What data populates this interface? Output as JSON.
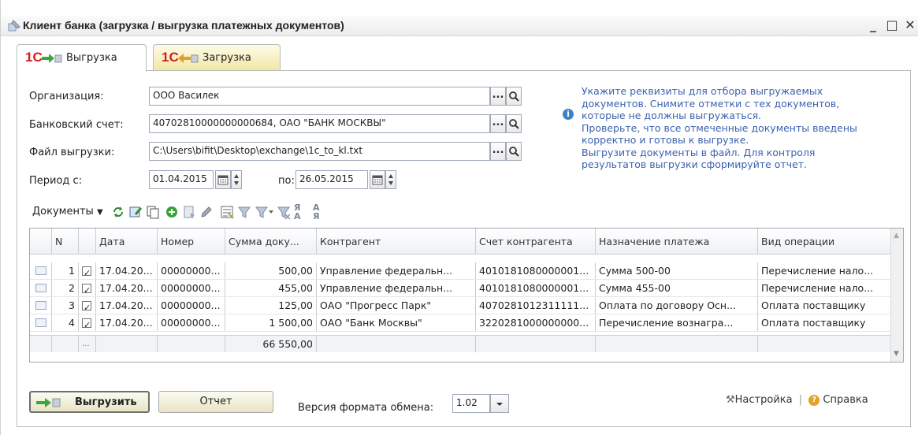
{
  "window": {
    "title": "Клиент банка (загрузка / выгрузка платежных документов)",
    "minimize_label": "_",
    "maximize_label": "□",
    "close_label": "✕"
  },
  "tabs": [
    {
      "label": "Выгрузка",
      "active": true
    },
    {
      "label": "Загрузка",
      "active": false
    }
  ],
  "form": {
    "organization_label": "Организация:",
    "organization_value": "ООО Василек",
    "bank_account_label": "Банковский счет:",
    "bank_account_value": "40702810000000000684, ОАО \"БАНК МОСКВЫ\"",
    "file_label": "Файл выгрузки:",
    "file_value": "C:\\Users\\bifit\\Desktop\\exchange\\1c_to_kl.txt",
    "period_label": "Период с:",
    "period_from": "01.04.2015",
    "period_to_label": "по:",
    "period_to": "26.05.2015",
    "select_button_label": "..."
  },
  "info": {
    "lines": [
      "Укажите реквизиты для отбора выгружаемых",
      "документов. Снимите отметки с тех документов,",
      "которые не должны выгружаться.",
      "Проверьте, что все отмеченные документы введены",
      "корректно и готовы к выгрузке.",
      "Выгрузите документы в файл. Для контроля",
      "результатов выгрузки сформируйте отчет."
    ]
  },
  "toolbar": {
    "documents_label": "Документы"
  },
  "table": {
    "columns": [
      "N",
      "",
      "Дата",
      "Номер",
      "Сумма доку...",
      "Контрагент",
      "Счет контрагента",
      "Назначение платежа",
      "Вид операции"
    ],
    "rows": [
      {
        "n": "1",
        "checked": true,
        "date": "17.04.20...",
        "number": "00000000...",
        "sum": "500,00",
        "counterparty": "Управление федеральн...",
        "account": "4010181080000001...",
        "purpose": "Сумма 500-00",
        "operation": "Перечисление нало..."
      },
      {
        "n": "2",
        "checked": true,
        "date": "17.04.20...",
        "number": "00000000...",
        "sum": "455,00",
        "counterparty": "Управление федеральн...",
        "account": "4010181080000001...",
        "purpose": "Сумма 455-00",
        "operation": "Перечисление нало..."
      },
      {
        "n": "3",
        "checked": true,
        "date": "17.04.20...",
        "number": "00000000...",
        "sum": "125,00",
        "counterparty": "ОАО \"Прогресс Парк\"",
        "account": "4070281012311111...",
        "purpose": "Оплата по договору Осн...",
        "operation": "Оплата поставщику"
      },
      {
        "n": "4",
        "checked": true,
        "date": "17.04.20...",
        "number": "00000000...",
        "sum": "1 500,00",
        "counterparty": "ОАО \"Банк Москвы\"",
        "account": "3220281000000000...",
        "purpose": "Перечисление вознагра...",
        "operation": "Оплата поставщику"
      }
    ],
    "footer": {
      "check": "...",
      "total": "66 550,00"
    }
  },
  "footer": {
    "export_button": "Выгрузить",
    "report_button": "Отчет",
    "version_label": "Версия формата обмена:",
    "version_value": "1.02",
    "settings_link": "Настройка",
    "separator": "|",
    "help_link": "Справка"
  },
  "colors": {
    "info_text": "#3b62b0",
    "logo_red": "#d0201b",
    "tab_inactive": "#f2e6a6"
  }
}
